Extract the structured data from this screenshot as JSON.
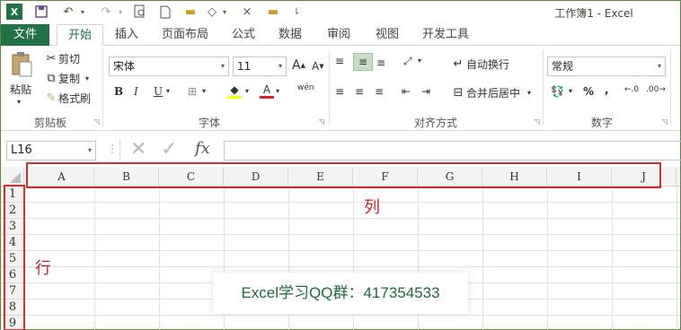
{
  "window": {
    "title": "工作簿1 - Excel"
  },
  "quick_access": {
    "excel_icon": "excel-logo-icon",
    "save": "save-icon",
    "undo": "undo-icon",
    "redo": "redo-icon"
  },
  "tabs": [
    {
      "label": "文件"
    },
    {
      "label": "开始"
    },
    {
      "label": "插入"
    },
    {
      "label": "页面布局"
    },
    {
      "label": "公式"
    },
    {
      "label": "数据"
    },
    {
      "label": "审阅"
    },
    {
      "label": "视图"
    },
    {
      "label": "开发工具"
    }
  ],
  "ribbon": {
    "clipboard": {
      "paste": "粘贴",
      "cut": "剪切",
      "copy": "复制",
      "format_painter": "格式刷",
      "label": "剪贴板"
    },
    "font": {
      "name": "宋体",
      "size": "11",
      "grow": "A",
      "shrink": "A",
      "bold": "B",
      "italic": "I",
      "underline": "U",
      "font_color": "A",
      "phonetic": "wén",
      "label": "字体"
    },
    "alignment": {
      "wrap": "自动换行",
      "merge": "合并后居中",
      "label": "对齐方式"
    },
    "number": {
      "format": "常规",
      "percent": "%",
      "comma": ",",
      "label": "数字"
    }
  },
  "formula_bar": {
    "name_box": "L16",
    "fx": "fx",
    "value": ""
  },
  "grid": {
    "columns": [
      "A",
      "B",
      "C",
      "D",
      "E",
      "F",
      "G",
      "H",
      "I",
      "J"
    ],
    "rows": [
      "1",
      "2",
      "3",
      "4",
      "5",
      "6",
      "7",
      "8",
      "9"
    ]
  },
  "annotations": {
    "column_label": "列",
    "row_label": "行"
  },
  "watermark": "Excel学习QQ群：417354533",
  "colors": {
    "accent": "#217346",
    "annotation": "#c0262b"
  }
}
